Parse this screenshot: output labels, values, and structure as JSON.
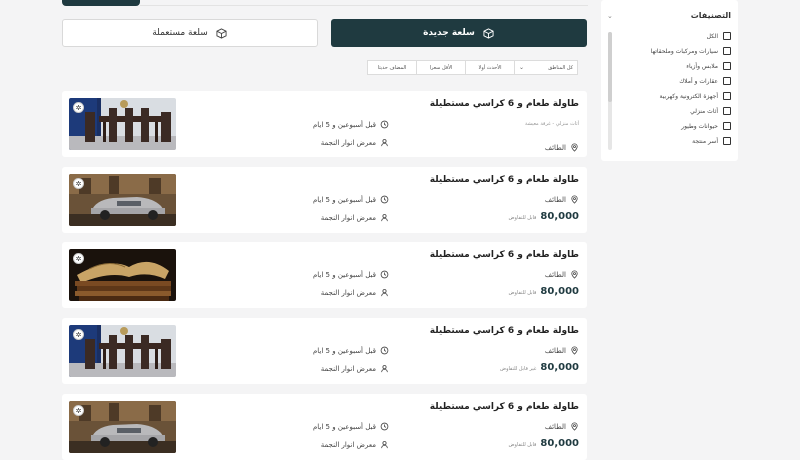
{
  "actions": {
    "new_item": "سلعة جديدة",
    "used_item": "سلعة مستعملة"
  },
  "sort": {
    "select_label": "كل المناطق",
    "options": [
      "الأحدث أولا",
      "الأقل سعرا",
      "المضاف حديثا"
    ]
  },
  "sidebar": {
    "title": "التصنيفات",
    "items": [
      "الكل",
      "سيارات ومركبات وملحقاتها",
      "ملابس وأزياء",
      "عقارات و أملاك",
      "أجهزة الكترونية وكهربية",
      "أثاث منزلي",
      "حيوانات وطيور",
      "أسر منتجة"
    ],
    "scroll_position": 0.0
  },
  "listings": [
    {
      "title": "طاولة طعام و 6 كراسي مستطيلة",
      "subcategory": "أثاث منزلي - غرفة معيشة",
      "location": "الطائف",
      "time": "قبل أسبوعين و 5 ايام",
      "seller": "معرض انوار النجمة",
      "price": "",
      "price_note": "",
      "image": "dining-table"
    },
    {
      "title": "طاولة طعام و 6 كراسي مستطيلة",
      "subcategory": "",
      "location": "الطائف",
      "time": "قبل أسبوعين و 5 ايام",
      "seller": "معرض انوار النجمة",
      "price": "80,000",
      "price_note": "قابل للتفاوض",
      "image": "car"
    },
    {
      "title": "طاولة طعام و 6 كراسي مستطيلة",
      "subcategory": "",
      "location": "الطائف",
      "time": "قبل أسبوعين و 5 ايام",
      "seller": "معرض انوار النجمة",
      "price": "80,000",
      "price_note": "قابل للتفاوض",
      "image": "books"
    },
    {
      "title": "طاولة طعام و 6 كراسي مستطيلة",
      "subcategory": "",
      "location": "الطائف",
      "time": "قبل أسبوعين و 5 ايام",
      "seller": "معرض انوار النجمة",
      "price": "80,000",
      "price_note": "غير قابل للتفاوض",
      "image": "dining-table"
    },
    {
      "title": "طاولة طعام و 6 كراسي مستطيلة",
      "subcategory": "",
      "location": "الطائف",
      "time": "قبل أسبوعين و 5 ايام",
      "seller": "معرض انوار النجمة",
      "price": "80,000",
      "price_note": "قابل للتفاوض",
      "image": "car"
    }
  ],
  "colors": {
    "primary": "#1f3a40",
    "page_bg": "#f4f4f5"
  }
}
